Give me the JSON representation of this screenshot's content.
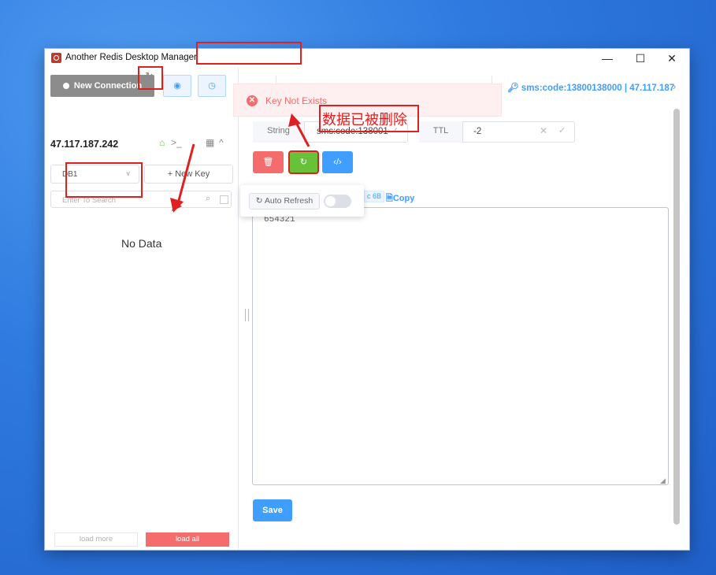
{
  "window": {
    "title": "Another Redis Desktop Manager",
    "minimize": "—",
    "maximize": "☐",
    "close": "✕"
  },
  "sidebar": {
    "new_connection": "New Connection",
    "server": "47.117.187.242",
    "db_select": "DB1",
    "new_key": "+ New Key",
    "search_placeholder": "Enter To Search",
    "no_data": "No Data",
    "load_more": "load more",
    "load_all": "load all"
  },
  "tab": {
    "breadcrumb": "sms:code:13800138000 | 47.117.187"
  },
  "key": {
    "type": "String",
    "name": "sms:code:138001",
    "ttl_label": "TTL",
    "ttl_value": "-2"
  },
  "toolbar": {
    "auto_refresh": "Auto Refresh",
    "auto_refresh_on": false
  },
  "value": {
    "size": "c 6B",
    "copy": "Copy",
    "text": "654321"
  },
  "save": "Save",
  "toast": {
    "message": "Key Not Exists"
  },
  "annotation": {
    "note": "数据已被删除"
  },
  "colors": {
    "primary": "#409eff",
    "danger": "#f56c6c",
    "success": "#67c23a",
    "annotation": "#e02020"
  }
}
